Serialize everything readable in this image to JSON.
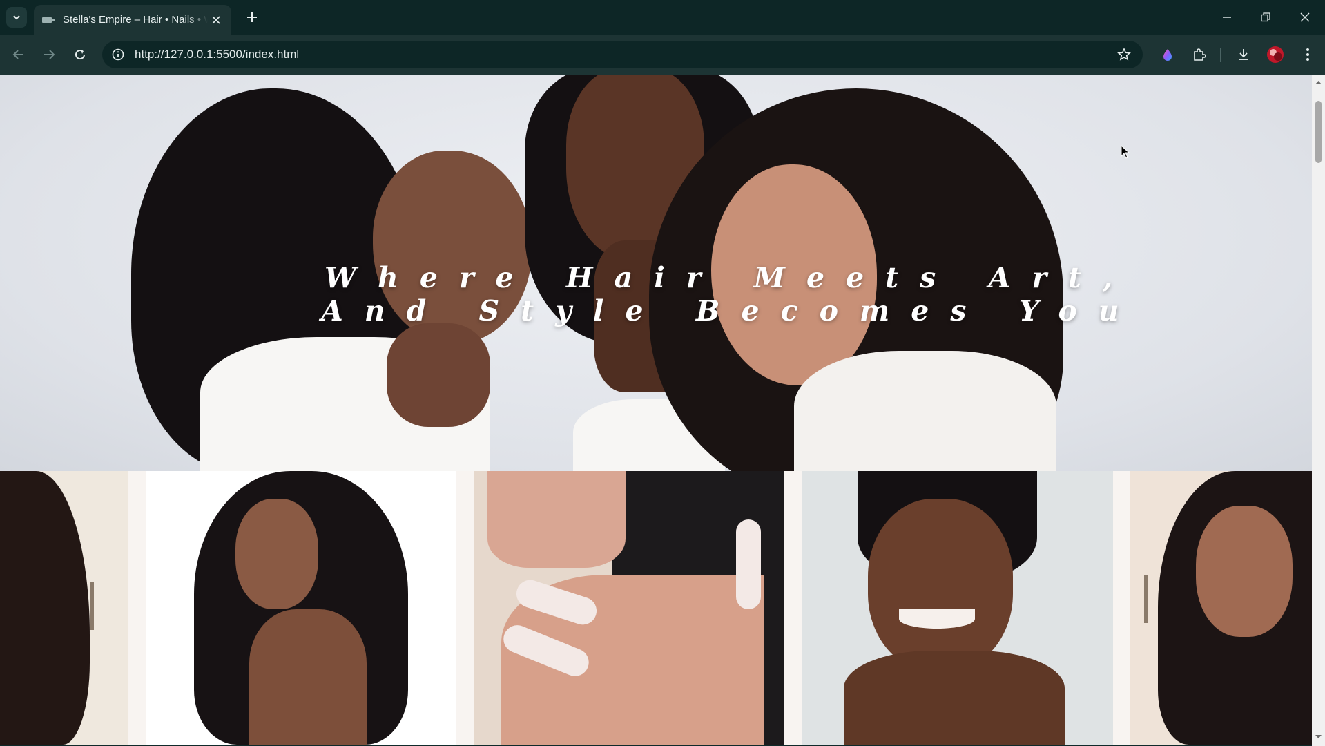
{
  "browser": {
    "tab_title": "Stella's Empire – Hair • Nails • W",
    "url": "http://127.0.0.1:5500/index.html",
    "accent": "#1d3434"
  },
  "hero": {
    "title_line1": "Where Hair Meets Art,",
    "title_line2": "And Style Becomes You"
  },
  "gallery": {
    "items": [
      {
        "icon": "curly-hair-portrait"
      },
      {
        "icon": "long-wavy-hair-portrait"
      },
      {
        "icon": "nail-art-photo"
      },
      {
        "icon": "braided-hair-portrait"
      },
      {
        "icon": "curly-wig-portrait"
      }
    ]
  }
}
